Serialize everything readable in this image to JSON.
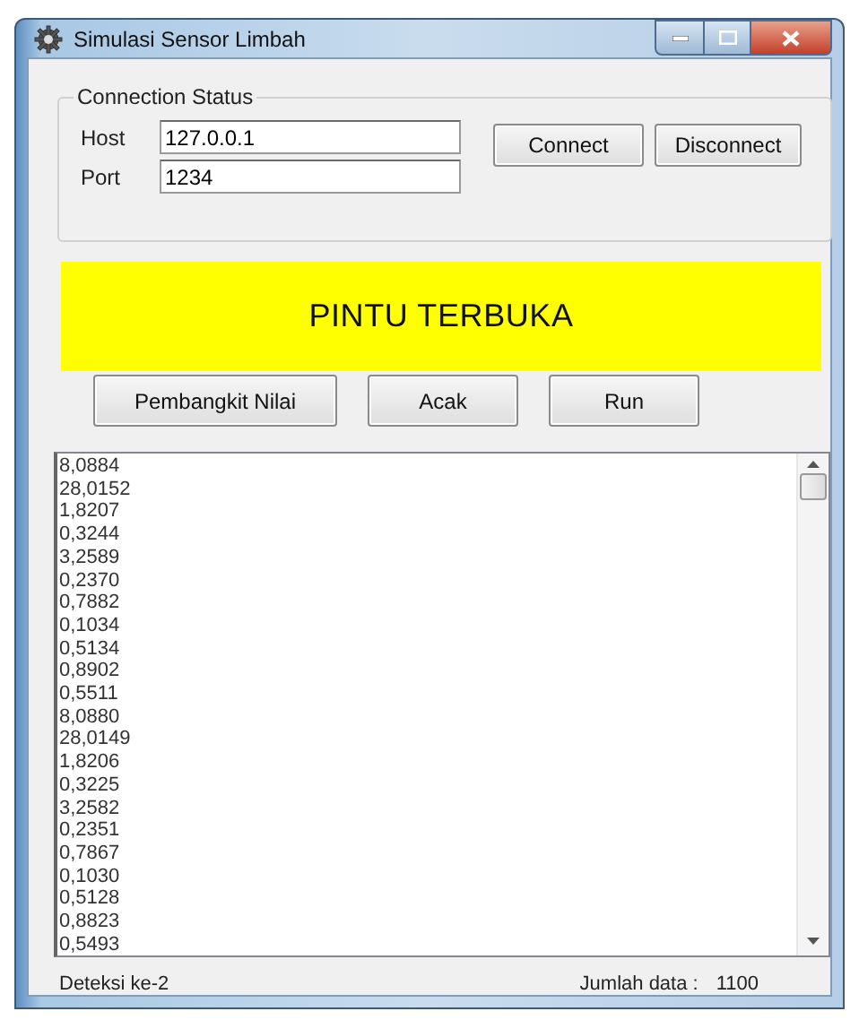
{
  "window": {
    "title": "Simulasi Sensor Limbah"
  },
  "connection": {
    "title": "Connection Status",
    "fields": [
      {
        "label": "Host",
        "value": "127.0.0.1"
      },
      {
        "label": "Port",
        "value": "1234"
      }
    ],
    "buttons": [
      "Connect",
      "Disconnect"
    ]
  },
  "banner": {
    "text": "PINTU TERBUKA"
  },
  "actions": [
    "Pembangkit Nilai",
    "Acak",
    "Run"
  ],
  "readings": [
    "8,0884",
    "28,0152",
    "1,8207",
    "0,3244",
    "3,2589",
    "0,2370",
    "0,7882",
    "0,1034",
    "0,5134",
    "0,8902",
    "0,5511",
    "8,0880",
    "28,0149",
    "1,8206",
    "0,3225",
    "3,2582",
    "0,2351",
    "0,7867",
    "0,1030",
    "0,5128",
    "0,8823",
    "0,5493"
  ],
  "status_bar": {
    "detection": "Deteksi ke-2",
    "count_label": "Jumlah data :",
    "count": "1100"
  }
}
